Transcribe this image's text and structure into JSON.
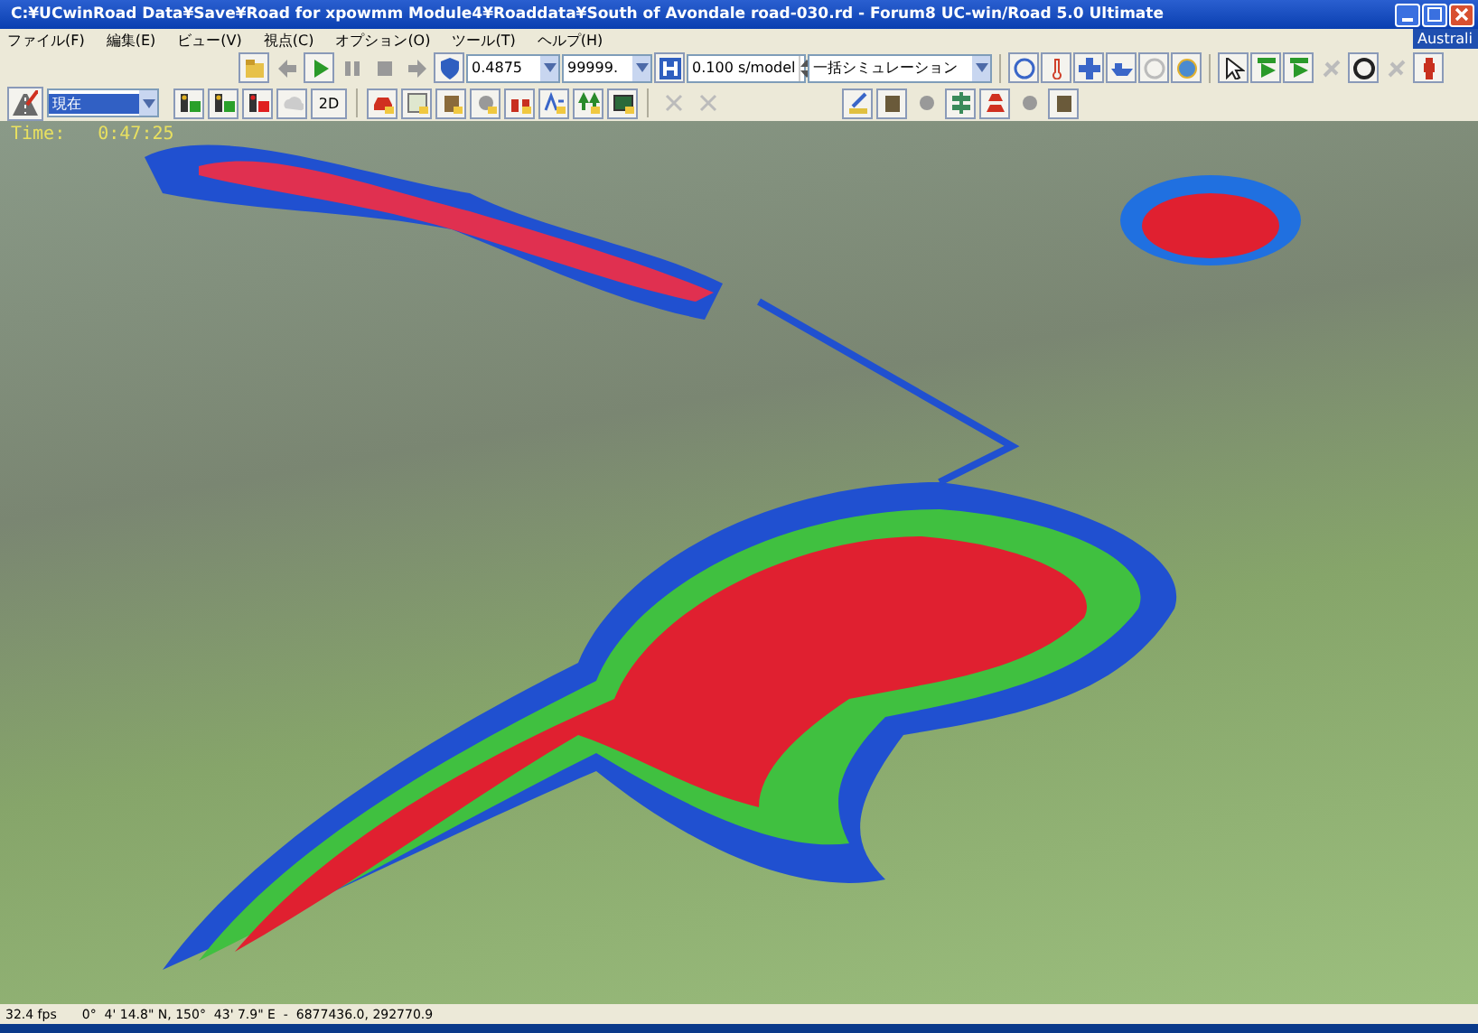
{
  "window": {
    "title": "C:¥UCwinRoad Data¥Save¥Road for xpowmm Module4¥Roaddata¥South of Avondale road-030.rd - Forum8 UC-win/Road 5.0 Ultimate",
    "corner_tab": "Australi"
  },
  "menu": [
    "ファイル(F)",
    "編集(E)",
    "ビュー(V)",
    "視点(C)",
    "オプション(O)",
    "ツール(T)",
    "ヘルプ(H)"
  ],
  "toolbar": {
    "fields": [
      {
        "value": "0.4875",
        "kind": "combo"
      },
      {
        "value": "99999.",
        "kind": "combo"
      },
      {
        "value": "0.100 s/model",
        "kind": "spin"
      },
      {
        "value": "一括シミュレーション",
        "kind": "combo"
      }
    ]
  },
  "toolbar2": {
    "view_select": "現在",
    "button_2d": "2D"
  },
  "viewport": {
    "time_label": "Time:",
    "time_value": "0:47:25"
  },
  "status_bar": {
    "fps": "32.4 fps",
    "coordinates": "0°  4' 14.8\" N, 150°  43' 7.9\" E  -  6877436.0, 292770.9"
  }
}
